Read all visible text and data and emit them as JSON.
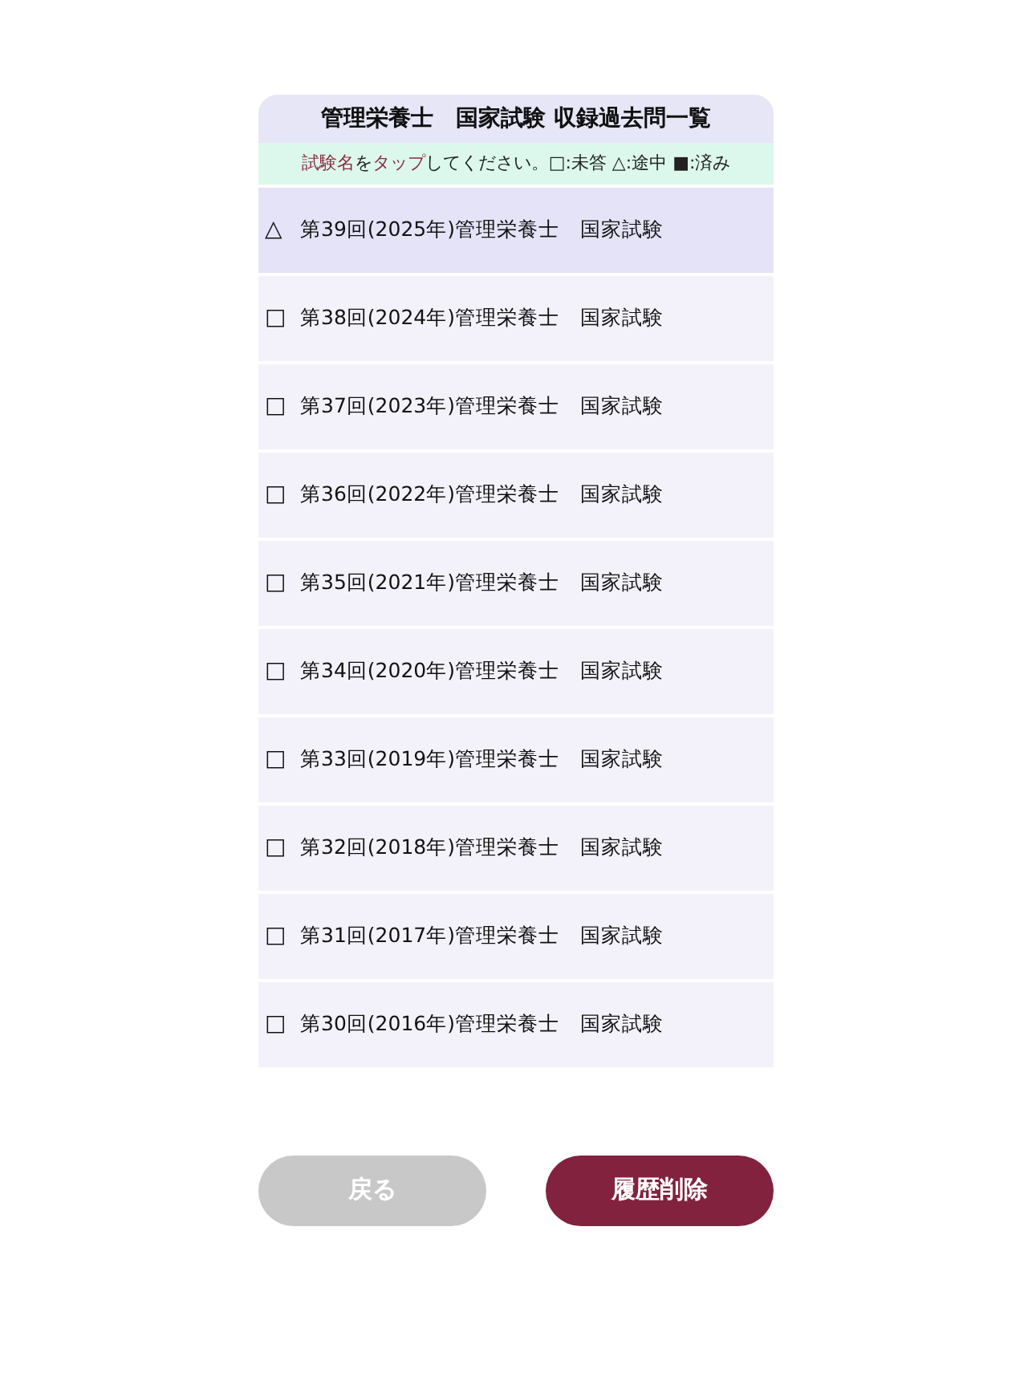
{
  "title": "管理栄養士　国家試験 収録過去問一覧",
  "hint": [
    {
      "text": "試験名",
      "accent": true
    },
    {
      "text": "を",
      "accent": false
    },
    {
      "text": "タップ",
      "accent": true
    },
    {
      "text": "してください。□:未答 △:途中 ■:済み",
      "accent": false
    }
  ],
  "exams": [
    {
      "marker": "△",
      "highlighted": true,
      "label": "第39回(2025年)管理栄養士　国家試験"
    },
    {
      "marker": "□",
      "highlighted": false,
      "label": "第38回(2024年)管理栄養士　国家試験"
    },
    {
      "marker": "□",
      "highlighted": false,
      "label": "第37回(2023年)管理栄養士　国家試験"
    },
    {
      "marker": "□",
      "highlighted": false,
      "label": "第36回(2022年)管理栄養士　国家試験"
    },
    {
      "marker": "□",
      "highlighted": false,
      "label": "第35回(2021年)管理栄養士　国家試験"
    },
    {
      "marker": "□",
      "highlighted": false,
      "label": "第34回(2020年)管理栄養士　国家試験"
    },
    {
      "marker": "□",
      "highlighted": false,
      "label": "第33回(2019年)管理栄養士　国家試験"
    },
    {
      "marker": "□",
      "highlighted": false,
      "label": "第32回(2018年)管理栄養士　国家試験"
    },
    {
      "marker": "□",
      "highlighted": false,
      "label": "第31回(2017年)管理栄養士　国家試験"
    },
    {
      "marker": "□",
      "highlighted": false,
      "label": "第30回(2016年)管理栄養士　国家試験"
    }
  ],
  "buttons": [
    {
      "label": "戻る",
      "kind": "back"
    },
    {
      "label": "履歴削除",
      "kind": "delete"
    }
  ]
}
